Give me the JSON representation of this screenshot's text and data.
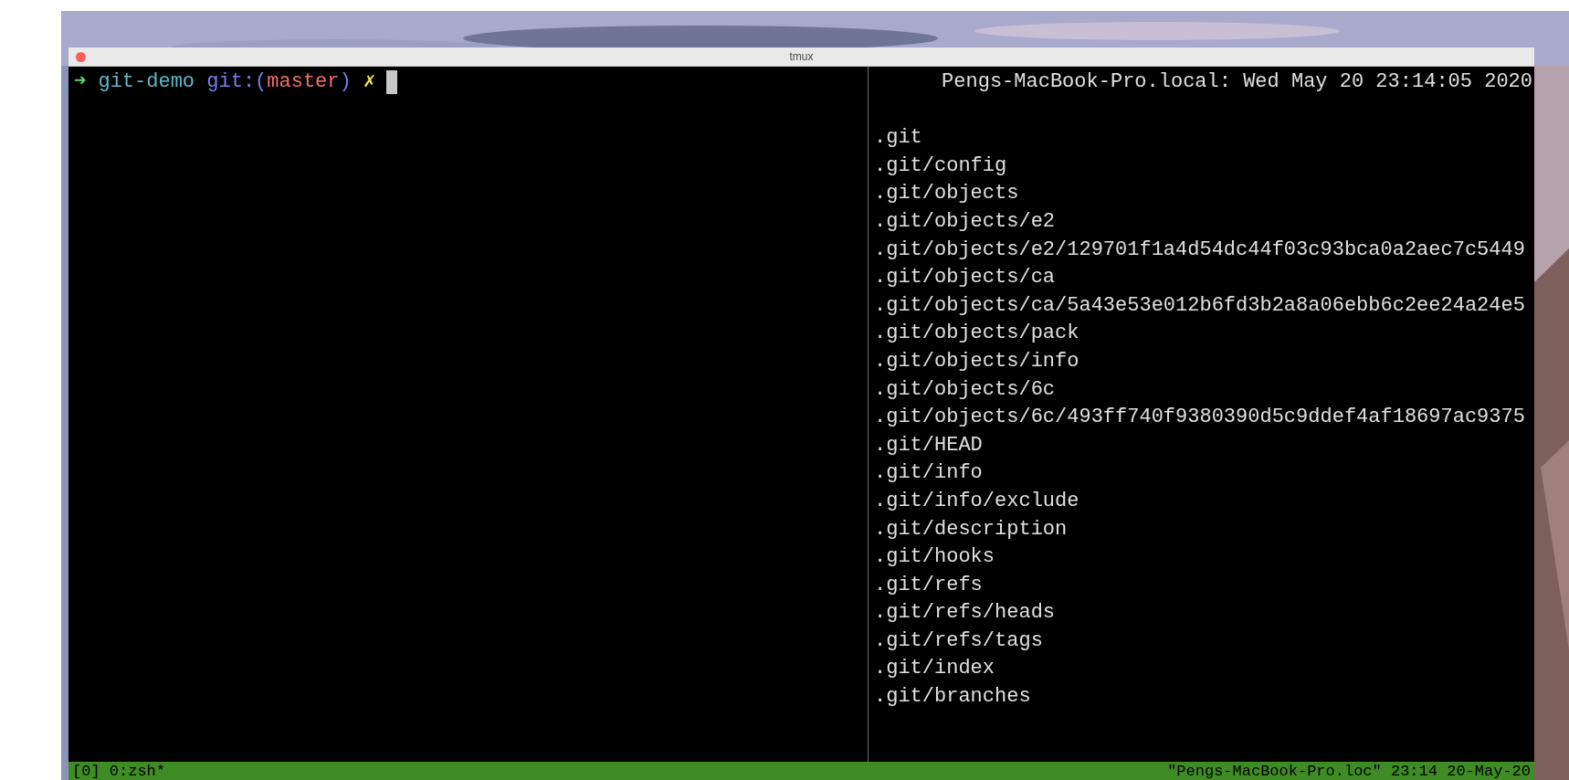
{
  "window": {
    "title": "tmux"
  },
  "left_pane": {
    "prompt": {
      "arrow": "➜",
      "directory": "git-demo",
      "branch_open": "git:(",
      "branch": "master",
      "branch_close": ")",
      "dirty_mark": "✗"
    }
  },
  "right_pane": {
    "header": "Pengs-MacBook-Pro.local: Wed May 20 23:14:05 2020",
    "lines": [
      ".git",
      ".git/config",
      ".git/objects",
      ".git/objects/e2",
      ".git/objects/e2/129701f1a4d54dc44f03c93bca0a2aec7c5449",
      ".git/objects/ca",
      ".git/objects/ca/5a43e53e012b6fd3b2a8a06ebb6c2ee24a24e5",
      ".git/objects/pack",
      ".git/objects/info",
      ".git/objects/6c",
      ".git/objects/6c/493ff740f9380390d5c9ddef4af18697ac9375",
      ".git/HEAD",
      ".git/info",
      ".git/info/exclude",
      ".git/description",
      ".git/hooks",
      ".git/refs",
      ".git/refs/heads",
      ".git/refs/tags",
      ".git/index",
      ".git/branches"
    ]
  },
  "status_bar": {
    "left": "[0] 0:zsh*",
    "right": "\"Pengs-MacBook-Pro.loc\" 23:14 20-May-20"
  }
}
